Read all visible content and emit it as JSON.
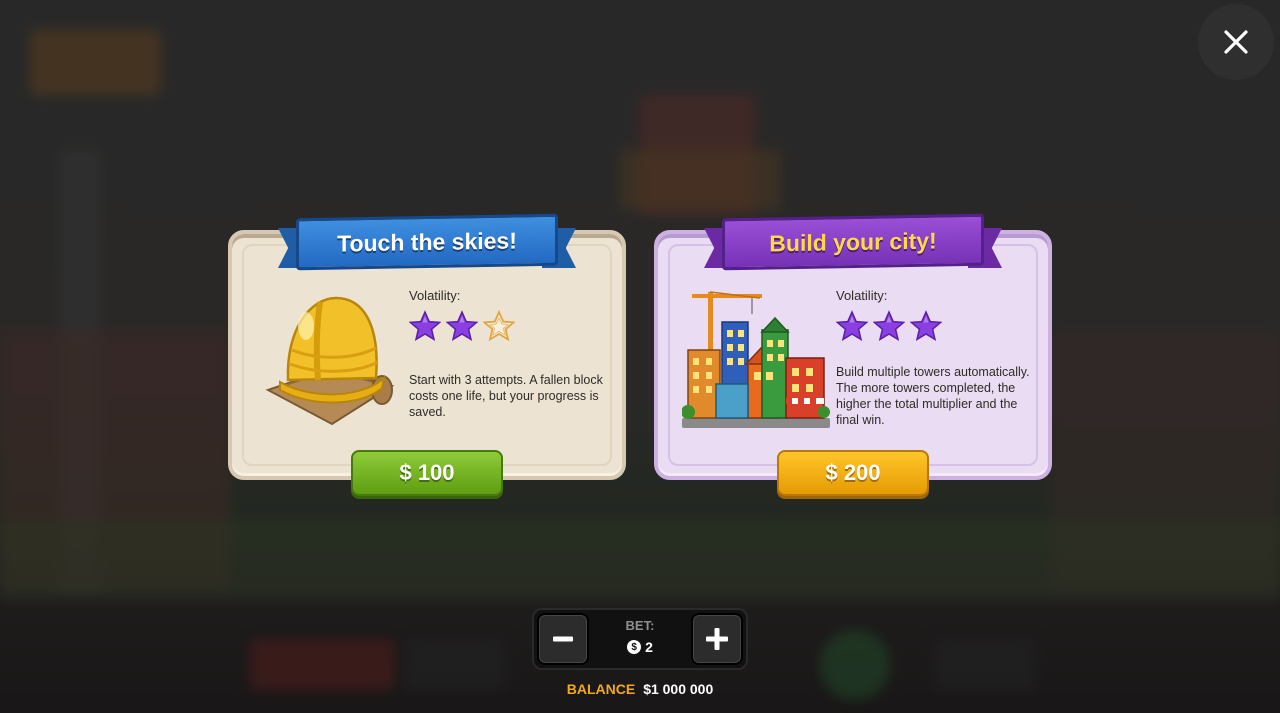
{
  "close": {
    "icon": "close-icon"
  },
  "modes": [
    {
      "title": "Touch the skies!",
      "volatility_label": "Volatility:",
      "volatility": 2,
      "volatility_max": 3,
      "description": "Start with 3 attempts. A fallen block costs one life, but your progress is saved.",
      "price": "$ 100",
      "illustration": "hard-hat-icon"
    },
    {
      "title": "Build your city!",
      "volatility_label": "Volatility:",
      "volatility": 3,
      "volatility_max": 3,
      "description": "Build multiple towers automatically. The more towers completed, the higher the total multiplier and the final win.",
      "price": "$ 200",
      "illustration": "city-buildings-icon"
    }
  ],
  "bet": {
    "label": "BET:",
    "value": "2",
    "currency_icon": "dollar-coin-icon"
  },
  "balance": {
    "label": "BALANCE",
    "value": "$1 000 000"
  },
  "colors": {
    "star_filled": "#8a3fe0",
    "accent_gold": "#f2a81d",
    "green_button": "#6fae1c",
    "gold_button": "#f1ad12"
  }
}
